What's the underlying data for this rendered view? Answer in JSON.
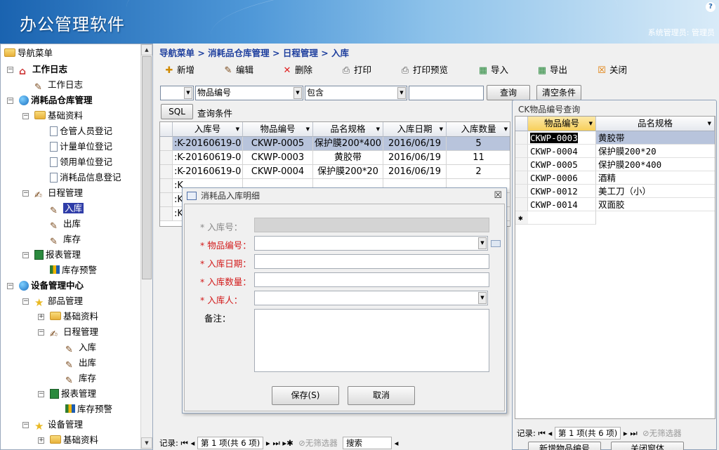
{
  "app": {
    "title": "办公管理软件",
    "user": "系统管理员: 管理员",
    "help": "?"
  },
  "nav": {
    "items": [
      {
        "label": "导航菜单",
        "icon": "folder-open-icon"
      },
      {
        "label": "工作日志",
        "icon": "house-icon"
      },
      {
        "label": "工作日志",
        "icon": "edit-icon"
      },
      {
        "label": "消耗品仓库管理",
        "icon": "globe-icon"
      },
      {
        "label": "基础资料",
        "icon": "folder-open-icon"
      },
      {
        "label": "仓管人员登记",
        "icon": "document-icon"
      },
      {
        "label": "计量单位登记",
        "icon": "document-icon"
      },
      {
        "label": "领用单位登记",
        "icon": "document-icon"
      },
      {
        "label": "消耗品信息登记",
        "icon": "document-icon"
      },
      {
        "label": "日程管理",
        "icon": "schedule-icon"
      },
      {
        "label": "入库",
        "icon": "edit-icon"
      },
      {
        "label": "出库",
        "icon": "edit-icon"
      },
      {
        "label": "库存",
        "icon": "edit-icon"
      },
      {
        "label": "报表管理",
        "icon": "report-icon"
      },
      {
        "label": "库存预警",
        "icon": "chart-icon"
      },
      {
        "label": "设备管理中心",
        "icon": "globe-icon"
      },
      {
        "label": "部品管理",
        "icon": "star-icon"
      },
      {
        "label": "基础资料",
        "icon": "folder-icon"
      },
      {
        "label": "日程管理",
        "icon": "schedule-icon"
      },
      {
        "label": "入库",
        "icon": "edit-icon"
      },
      {
        "label": "出库",
        "icon": "edit-icon"
      },
      {
        "label": "库存",
        "icon": "edit-icon"
      },
      {
        "label": "报表管理",
        "icon": "report-icon"
      },
      {
        "label": "库存预警",
        "icon": "chart-icon"
      },
      {
        "label": "设备管理",
        "icon": "star-icon"
      },
      {
        "label": "基础资料",
        "icon": "folder-icon"
      }
    ]
  },
  "breadcrumb": "导航菜单 > 消耗品仓库管理 > 日程管理 > 入库",
  "toolbar": {
    "add": "新增",
    "edit": "编辑",
    "delete": "删除",
    "print": "打印",
    "print_preview": "打印预览",
    "import": "导入",
    "export": "导出",
    "close": "关闭"
  },
  "filter": {
    "field": "物品编号",
    "op": "包含",
    "query": "查询",
    "clear": "清空条件",
    "sql": "SQL",
    "condition_label": "查询条件"
  },
  "grid": {
    "columns": [
      "入库号",
      "物品编号",
      "品名规格",
      "入库日期",
      "入库数量"
    ],
    "rows": [
      [
        ":K-20160619-0",
        "CKWP-0005",
        "保护膜200*400",
        "2016/06/19",
        "5"
      ],
      [
        ":K-20160619-0",
        "CKWP-0003",
        "黄胶带",
        "2016/06/19",
        "11"
      ],
      [
        ":K-20160619-0",
        "CKWP-0004",
        "保护膜200*20",
        "2016/06/19",
        "2"
      ],
      [
        ":K",
        "",
        "",
        "",
        ""
      ],
      [
        ":K",
        "",
        "",
        "",
        ""
      ],
      [
        ":K",
        "",
        "",
        "",
        ""
      ]
    ]
  },
  "status": {
    "record_label": "记录:",
    "page": "第 1 项(共 6 项)",
    "no_filter": "无筛选器",
    "search": "搜索"
  },
  "dialog": {
    "title": "消耗品入库明细",
    "close": "☒",
    "fields": {
      "receipt_no": "* 入库号：",
      "item_code": "* 物品编号：",
      "date": "* 入库日期：",
      "quantity": "* 入库数量：",
      "person": "* 入库人：",
      "notes": "备注："
    },
    "save": "保存(S)",
    "cancel": "取消"
  },
  "lookup": {
    "title": "CK物品编号查询",
    "columns": [
      "物品编号",
      "品名规格"
    ],
    "rows": [
      [
        "CKWP-0003",
        "黄胶带"
      ],
      [
        "CKWP-0004",
        "保护膜200*20"
      ],
      [
        "CKWP-0005",
        "保护膜200*400"
      ],
      [
        "CKWP-0006",
        "酒精"
      ],
      [
        "CKWP-0012",
        "美工刀（小）"
      ],
      [
        "CKWP-0014",
        "双面胶"
      ]
    ],
    "new_row": "✱",
    "page": "第 1 项(共 6 项)",
    "no_filter": "无筛选器",
    "add_button": "新增物品编号",
    "close_button": "关闭窗体"
  }
}
